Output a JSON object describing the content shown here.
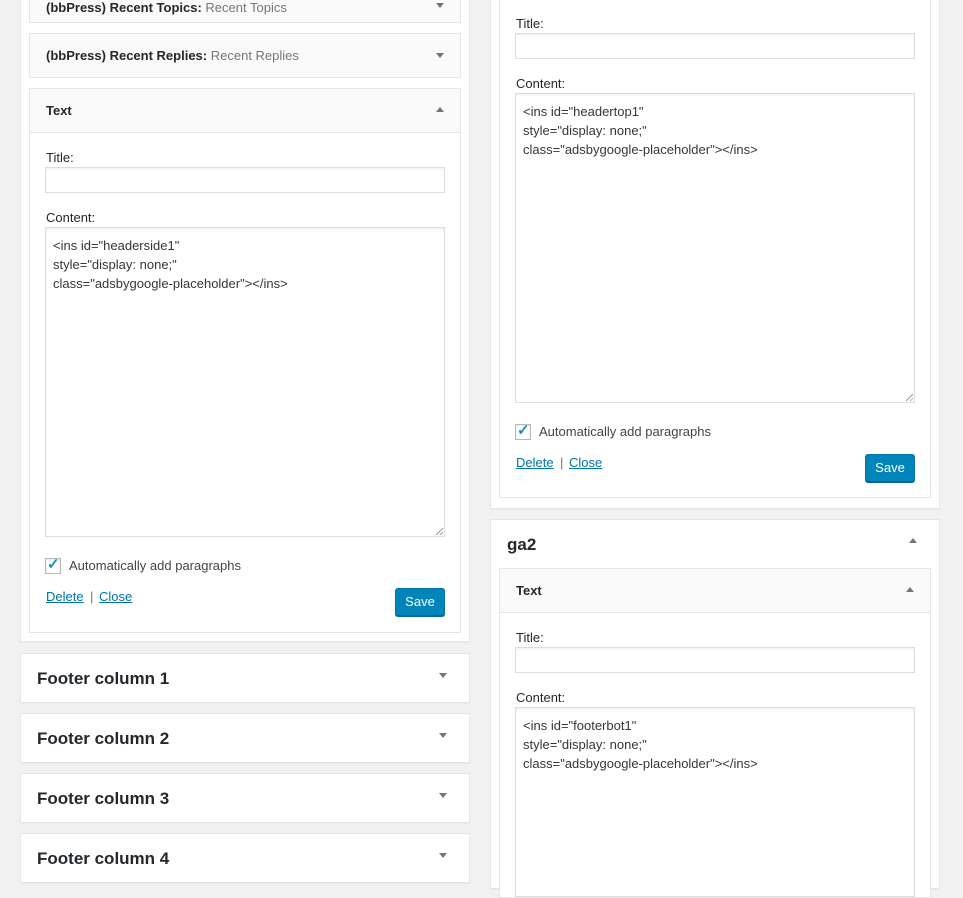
{
  "left": {
    "widgets_collapsed": [
      {
        "title": "(bbPress) Recent Topics:",
        "in_title": "Recent Topics"
      },
      {
        "title": "(bbPress) Recent Replies:",
        "in_title": "Recent Replies"
      }
    ],
    "text_widget": {
      "title": "Text",
      "title_label": "Title:",
      "title_value": "",
      "content_label": "Content:",
      "content_value": "<ins id=\"headerside1\"\nstyle=\"display: none;\"\nclass=\"adsbygoogle-placeholder\"></ins>",
      "auto_paragraphs_label": "Automatically add paragraphs",
      "auto_paragraphs_checked": true,
      "delete_label": "Delete",
      "separator": "|",
      "close_label": "Close",
      "save_label": "Save"
    },
    "sidebars": [
      {
        "title": "Footer column 1"
      },
      {
        "title": "Footer column 2"
      },
      {
        "title": "Footer column 3"
      },
      {
        "title": "Footer column 4"
      }
    ]
  },
  "right": {
    "top_text_widget": {
      "title_label": "Title:",
      "title_value": "",
      "content_label": "Content:",
      "content_value": "<ins id=\"headertop1\"\nstyle=\"display: none;\"\nclass=\"adsbygoogle-placeholder\"></ins>",
      "auto_paragraphs_label": "Automatically add paragraphs",
      "auto_paragraphs_checked": true,
      "delete_label": "Delete",
      "separator": "|",
      "close_label": "Close",
      "save_label": "Save"
    },
    "sidebar_ga2": {
      "title": "ga2",
      "text_widget": {
        "title": "Text",
        "title_label": "Title:",
        "title_value": "",
        "content_label": "Content:",
        "content_value": "<ins id=\"footerbot1\"\nstyle=\"display: none;\"\nclass=\"adsbygoogle-placeholder\"></ins>"
      }
    }
  },
  "colors": {
    "accent": "#0085ba",
    "link": "#0073aa",
    "checkmark": "#1e8cbe",
    "background": "#f1f1f1"
  },
  "icons": {
    "collapse": "triangle-up-icon",
    "expand": "triangle-down-icon",
    "check": "checkmark-icon",
    "resize": "resize-grip-icon"
  }
}
